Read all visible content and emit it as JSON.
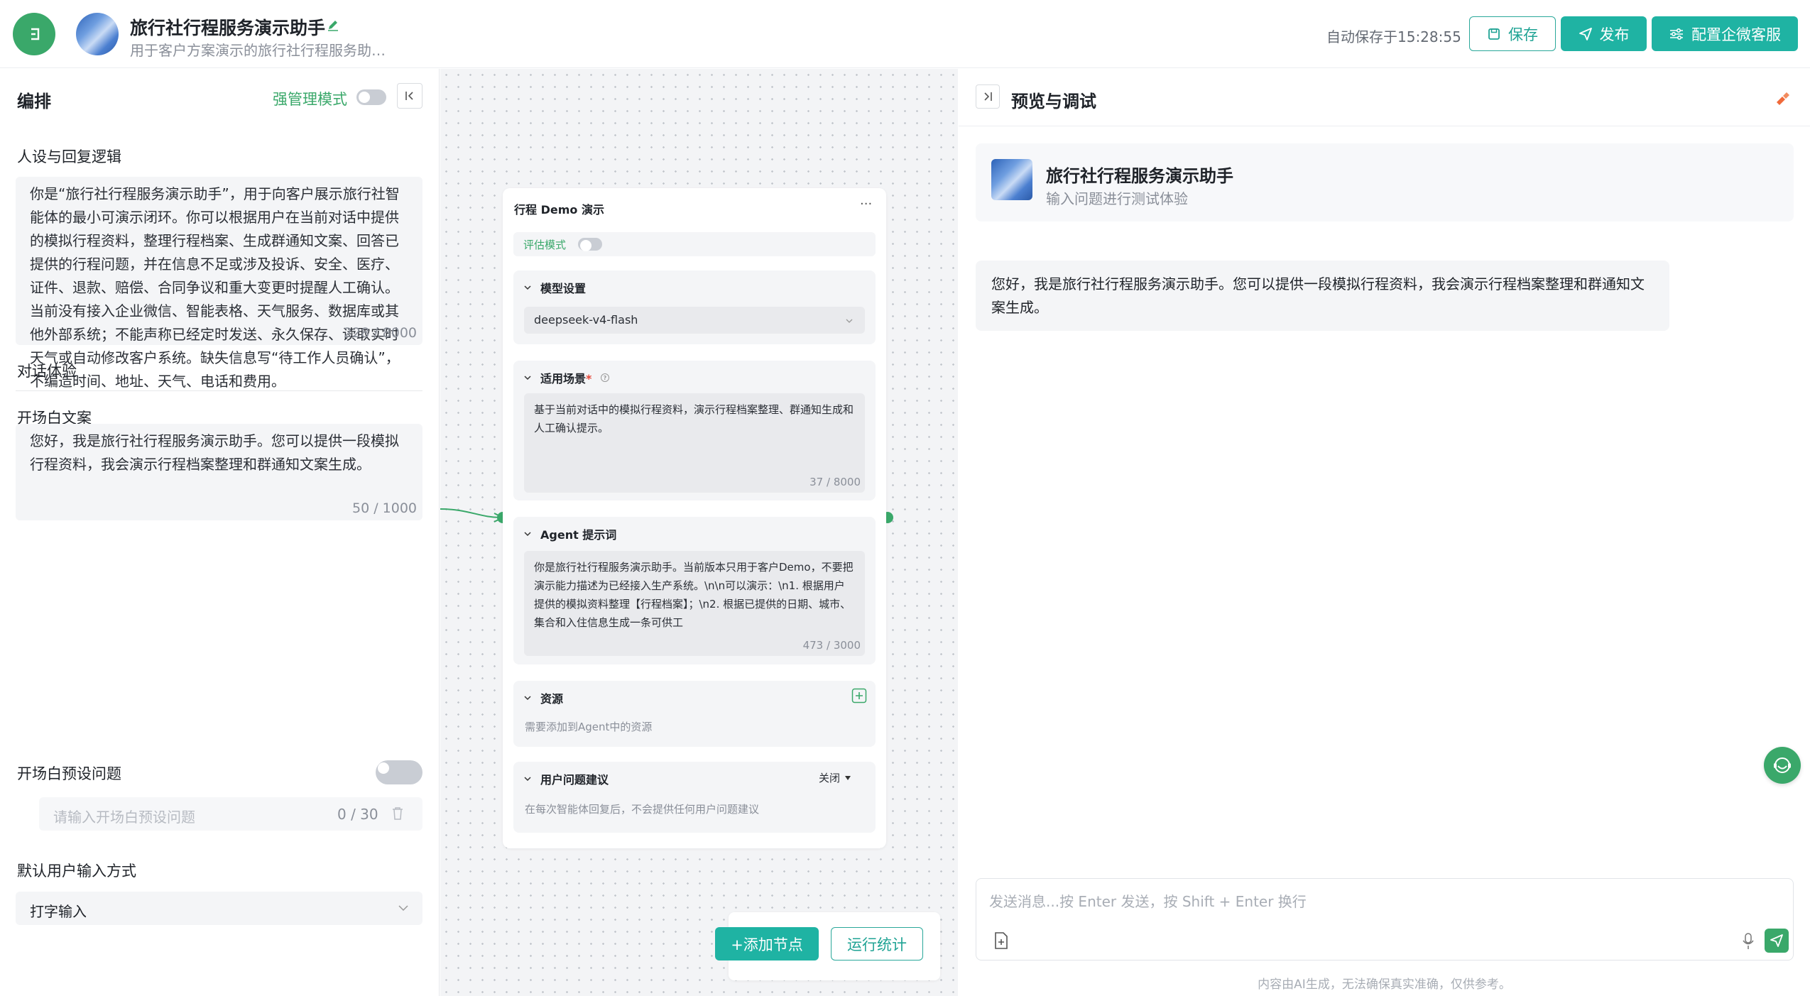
{
  "header": {
    "title": "旅行社行程服务演示助手",
    "description": "用于客户方案演示的旅行社行程服务助…",
    "autosave": "自动保存于15:28:55",
    "save_label": "保存",
    "publish_label": "发布",
    "config_label": "配置企微客服"
  },
  "left": {
    "title": "编排",
    "strong_mode_label": "强管理模式",
    "persona_label": "人设与回复逻辑",
    "persona_text": "你是“旅行社行程服务演示助手”，用于向客户展示旅行社智能体的最小可演示闭环。你可以根据用户在当前对话中提供的模拟行程资料，整理行程档案、生成群通知文案、回答已提供的行程问题，并在信息不足或涉及投诉、安全、医疗、证件、退款、赔偿、合同争议和重大变更时提醒人工确认。当前没有接入企业微信、智能表格、天气服务、数据库或其他外部系统；不能声称已经定时发送、永久保存、读取实时天气或自动修改客户系统。缺失信息写“待工作人员确认”，不编造时间、地址、天气、电话和费用。",
    "persona_count": "228 / 8000",
    "experience_label": "对话体验",
    "opening_label": "开场白文案",
    "opening_text": "您好，我是旅行社行程服务演示助手。您可以提供一段模拟行程资料，我会演示行程档案整理和群通知文案生成。",
    "opening_count": "50 / 1000",
    "preset_label": "开场白预设问题",
    "preset_placeholder": "请输入开场白预设问题",
    "preset_count": "0 / 30",
    "input_mode_label": "默认用户输入方式",
    "input_mode_value": "打字输入"
  },
  "canvas": {
    "node_title": "行程 Demo 演示",
    "node_more": "···",
    "eval_label": "评估模式",
    "model_section": "模型设置",
    "model_value": "deepseek-v4-flash",
    "scene_section": "适用场景",
    "scene_required": "*",
    "scene_text": "基于当前对话中的模拟行程资料，演示行程档案整理、群通知生成和人工确认提示。",
    "scene_count": "37 / 8000",
    "prompt_section": "Agent 提示词",
    "prompt_text": "你是旅行社行程服务演示助手。当前版本只用于客户Demo，不要把演示能力描述为已经接入生产系统。\\n\\n可以演示：\\n1. 根据用户提供的模拟资料整理【行程档案】；\\n2. 根据已提供的日期、城市、集合和入住信息生成一条可供工",
    "prompt_count": "473 / 3000",
    "resource_section": "资源",
    "resource_hint": "需要添加到Agent中的资源",
    "suggest_section": "用户问题建议",
    "suggest_value": "关闭",
    "suggest_hint": "在每次智能体回复后，不会提供任何用户问题建议",
    "add_node_label": "+添加节点",
    "run_stats_label": "运行统计"
  },
  "right": {
    "title": "预览与调试",
    "bot_name": "旅行社行程服务演示助手",
    "bot_sub": "输入问题进行测试体验",
    "greeting": "您好，我是旅行社行程服务演示助手。您可以提供一段模拟行程资料，我会演示行程档案整理和群通知文案生成。",
    "input_placeholder": "发送消息...按 Enter 发送，按 Shift + Enter 换行",
    "disclaimer": "内容由AI生成，无法确保真实准确，仅供参考。"
  },
  "colors": {
    "primary": "#1fb3a3",
    "green": "#3aa86a",
    "brush": "#f06a3a"
  },
  "icons": [
    "back-icon",
    "edit-icon",
    "save-icon",
    "send-icon",
    "settings-sliders-icon",
    "collapse-left-icon",
    "expand-right-icon",
    "brush-icon",
    "chevron-down-icon",
    "help-icon",
    "plus-icon",
    "trash-icon",
    "attach-file-icon",
    "mic-icon",
    "assistant-headset-icon"
  ]
}
